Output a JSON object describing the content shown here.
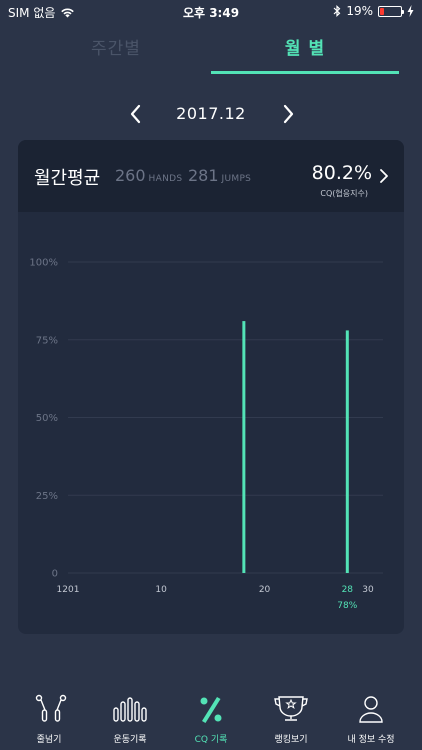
{
  "status_bar": {
    "carrier": "SIM 없음",
    "time": "오후 3:49",
    "battery_percent": "19%",
    "battery_level": 0.19
  },
  "tabs": {
    "weekly": "주간별",
    "monthly": "월 별"
  },
  "month_nav": {
    "current": "2017.12"
  },
  "summary": {
    "title": "월간평균",
    "hands_value": "260",
    "hands_unit": "HANDS",
    "jumps_value": "281",
    "jumps_unit": "JUMPS",
    "cq_value": "80.2%",
    "cq_label": "CQ(협응지수)"
  },
  "chart_data": {
    "type": "bar",
    "ylim": [
      0,
      100
    ],
    "y_ticks": [
      {
        "value": 100,
        "label": "100%"
      },
      {
        "value": 75,
        "label": "75%"
      },
      {
        "value": 50,
        "label": "50%"
      },
      {
        "value": 25,
        "label": "25%"
      },
      {
        "value": 0,
        "label": "0"
      }
    ],
    "xlim": [
      1,
      31
    ],
    "x_ticks": [
      {
        "day": 1,
        "label": "1201"
      },
      {
        "day": 10,
        "label": "10"
      },
      {
        "day": 20,
        "label": "20"
      },
      {
        "day": 28,
        "label": "28",
        "highlight": true
      },
      {
        "day": 30,
        "label": "30"
      }
    ],
    "bars": [
      {
        "day": 18,
        "value": 81
      },
      {
        "day": 28,
        "value": 78
      }
    ],
    "data_labels": [
      {
        "day": 28,
        "text": "78%"
      }
    ],
    "bar_color": "#53e3b6"
  },
  "bottom_nav": {
    "items": [
      {
        "key": "jumprope",
        "label": "줄넘기"
      },
      {
        "key": "exercise",
        "label": "운동기록"
      },
      {
        "key": "cq",
        "label": "CQ 기록",
        "active": true
      },
      {
        "key": "ranking",
        "label": "랭킹보기"
      },
      {
        "key": "profile",
        "label": "내 정보 수정"
      }
    ]
  },
  "colors": {
    "background": "#2b3448",
    "card": "#222b3e",
    "card_header": "#1b2333",
    "accent": "#53e3b6",
    "muted": "#6c7487"
  }
}
